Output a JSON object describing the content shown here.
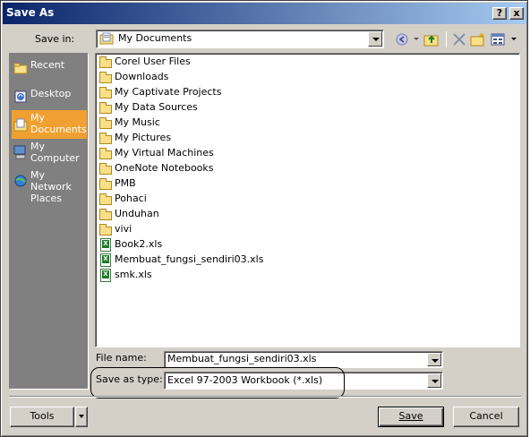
{
  "window": {
    "title": "Save As",
    "help_label": "?",
    "close_label": "x"
  },
  "toolbar": {
    "save_in_label": "Save in:",
    "save_in_value": "My Documents",
    "icons": [
      "back-icon",
      "up-folder-icon",
      "delete-icon",
      "new-folder-icon",
      "views-icon"
    ]
  },
  "places": [
    {
      "label": "Recent"
    },
    {
      "label": "Desktop"
    },
    {
      "label": "My Documents",
      "selected": true
    },
    {
      "label": "My Computer"
    },
    {
      "label": "My Network Places"
    }
  ],
  "files": [
    {
      "name": "Corel User Files",
      "type": "folder"
    },
    {
      "name": "Downloads",
      "type": "folder"
    },
    {
      "name": "My Captivate Projects",
      "type": "folder"
    },
    {
      "name": "My Data Sources",
      "type": "folder"
    },
    {
      "name": "My Music",
      "type": "folder"
    },
    {
      "name": "My Pictures",
      "type": "folder"
    },
    {
      "name": "My Virtual Machines",
      "type": "folder"
    },
    {
      "name": "OneNote Notebooks",
      "type": "folder"
    },
    {
      "name": "PMB",
      "type": "folder"
    },
    {
      "name": "Pohaci",
      "type": "folder"
    },
    {
      "name": "Unduhan",
      "type": "folder"
    },
    {
      "name": "vivi",
      "type": "folder"
    },
    {
      "name": "Book2.xls",
      "type": "xls"
    },
    {
      "name": "Membuat_fungsi_sendiri03.xls",
      "type": "xls"
    },
    {
      "name": "smk.xls",
      "type": "xls"
    }
  ],
  "form": {
    "file_name_label": "File name:",
    "file_name_value": "Membuat_fungsi_sendiri03.xls",
    "save_as_type_label": "Save as type:",
    "save_as_type_value": "Excel 97-2003 Workbook (*.xls)"
  },
  "buttons": {
    "tools_label": "Tools",
    "save_label": "Save",
    "cancel_label": "Cancel"
  }
}
